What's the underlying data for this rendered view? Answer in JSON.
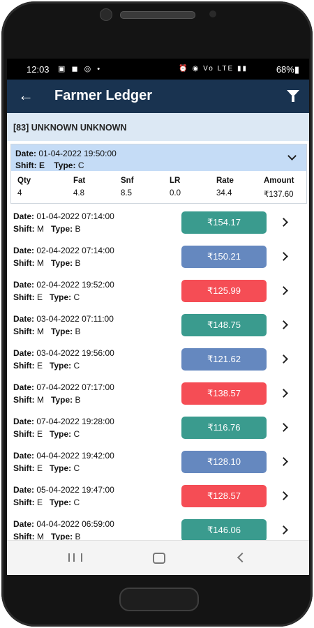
{
  "status": {
    "time": "12:03",
    "left_icons": "▣ ◼ ◎ •",
    "right_icons": "⏰ ◉ Vo LTE ▮▮",
    "battery": "68%▮"
  },
  "appbar": {
    "back": "←",
    "title": "Farmer Ledger"
  },
  "farmer": "[83] UNKNOWN UNKNOWN",
  "labels": {
    "date": "Date:",
    "shift": "Shift:",
    "type": "Type:"
  },
  "expanded": {
    "date": "01-04-2022 19:50:00",
    "shift": "E",
    "type": "C",
    "headers": [
      "Qty",
      "Fat",
      "Snf",
      "LR",
      "Rate",
      "Amount"
    ],
    "values": [
      "4",
      "4.8",
      "8.5",
      "0.0",
      "34.4",
      "₹137.60"
    ]
  },
  "colors": {
    "appbar": "#193350",
    "green": "#3a9b8e",
    "blue": "#6588bf",
    "red": "#f54d55"
  },
  "entries": [
    {
      "date": "01-04-2022 07:14:00",
      "shift": "M",
      "type": "B",
      "amount": "₹154.17",
      "color": "#3a9b8e"
    },
    {
      "date": "02-04-2022 07:14:00",
      "shift": "M",
      "type": "B",
      "amount": "₹150.21",
      "color": "#6588bf"
    },
    {
      "date": "02-04-2022 19:52:00",
      "shift": "E",
      "type": "C",
      "amount": "₹125.99",
      "color": "#f54d55"
    },
    {
      "date": "03-04-2022 07:11:00",
      "shift": "M",
      "type": "B",
      "amount": "₹148.75",
      "color": "#3a9b8e"
    },
    {
      "date": "03-04-2022 19:56:00",
      "shift": "E",
      "type": "C",
      "amount": "₹121.62",
      "color": "#6588bf"
    },
    {
      "date": "07-04-2022 07:17:00",
      "shift": "M",
      "type": "B",
      "amount": "₹138.57",
      "color": "#f54d55"
    },
    {
      "date": "07-04-2022 19:28:00",
      "shift": "E",
      "type": "C",
      "amount": "₹116.76",
      "color": "#3a9b8e"
    },
    {
      "date": "04-04-2022 19:42:00",
      "shift": "E",
      "type": "C",
      "amount": "₹128.10",
      "color": "#6588bf"
    },
    {
      "date": "05-04-2022 19:47:00",
      "shift": "E",
      "type": "C",
      "amount": "₹128.57",
      "color": "#f54d55"
    },
    {
      "date": "04-04-2022 06:59:00",
      "shift": "M",
      "type": "B",
      "amount": "₹146.06",
      "color": "#3a9b8e"
    }
  ]
}
